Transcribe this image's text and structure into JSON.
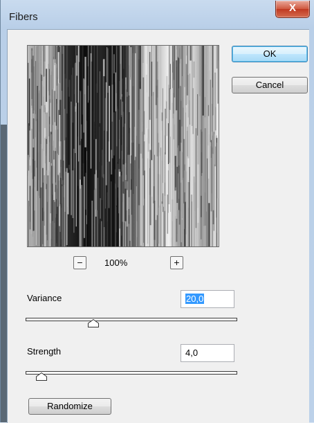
{
  "window": {
    "title": "Fibers",
    "close_glyph": "X"
  },
  "buttons": {
    "ok": "OK",
    "cancel": "Cancel",
    "randomize": "Randomize"
  },
  "zoom": {
    "minus": "−",
    "plus": "+",
    "value": "100%"
  },
  "variance": {
    "label": "Variance",
    "value": "20,0",
    "slider_fraction": 0.31
  },
  "strength": {
    "label": "Strength",
    "value": "4,0",
    "slider_fraction": 0.05
  },
  "icons": {
    "close": "close-icon",
    "zoom_out": "zoom-out-icon",
    "zoom_in": "zoom-in-icon"
  },
  "colors": {
    "close_red": "#c03a22",
    "default_button": "#bee6fd",
    "selection": "#3399ff"
  }
}
